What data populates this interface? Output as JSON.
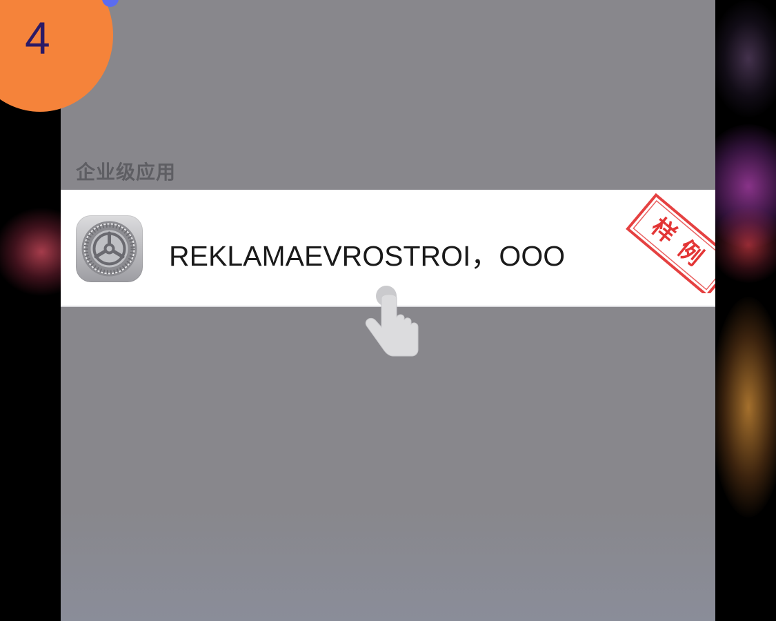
{
  "step_badge": {
    "number": "4",
    "color": "#f5833a",
    "accent_color": "#5b6cf0",
    "text_color": "#2b1a66"
  },
  "screen": {
    "section_header": "企业级应用",
    "app_row": {
      "icon": "settings-gear-icon",
      "name": "REKLAMAEVROSTROI，OOO"
    },
    "stamp": {
      "text": "样例",
      "color": "#e02020"
    },
    "pointer": "tap-hand-icon"
  }
}
